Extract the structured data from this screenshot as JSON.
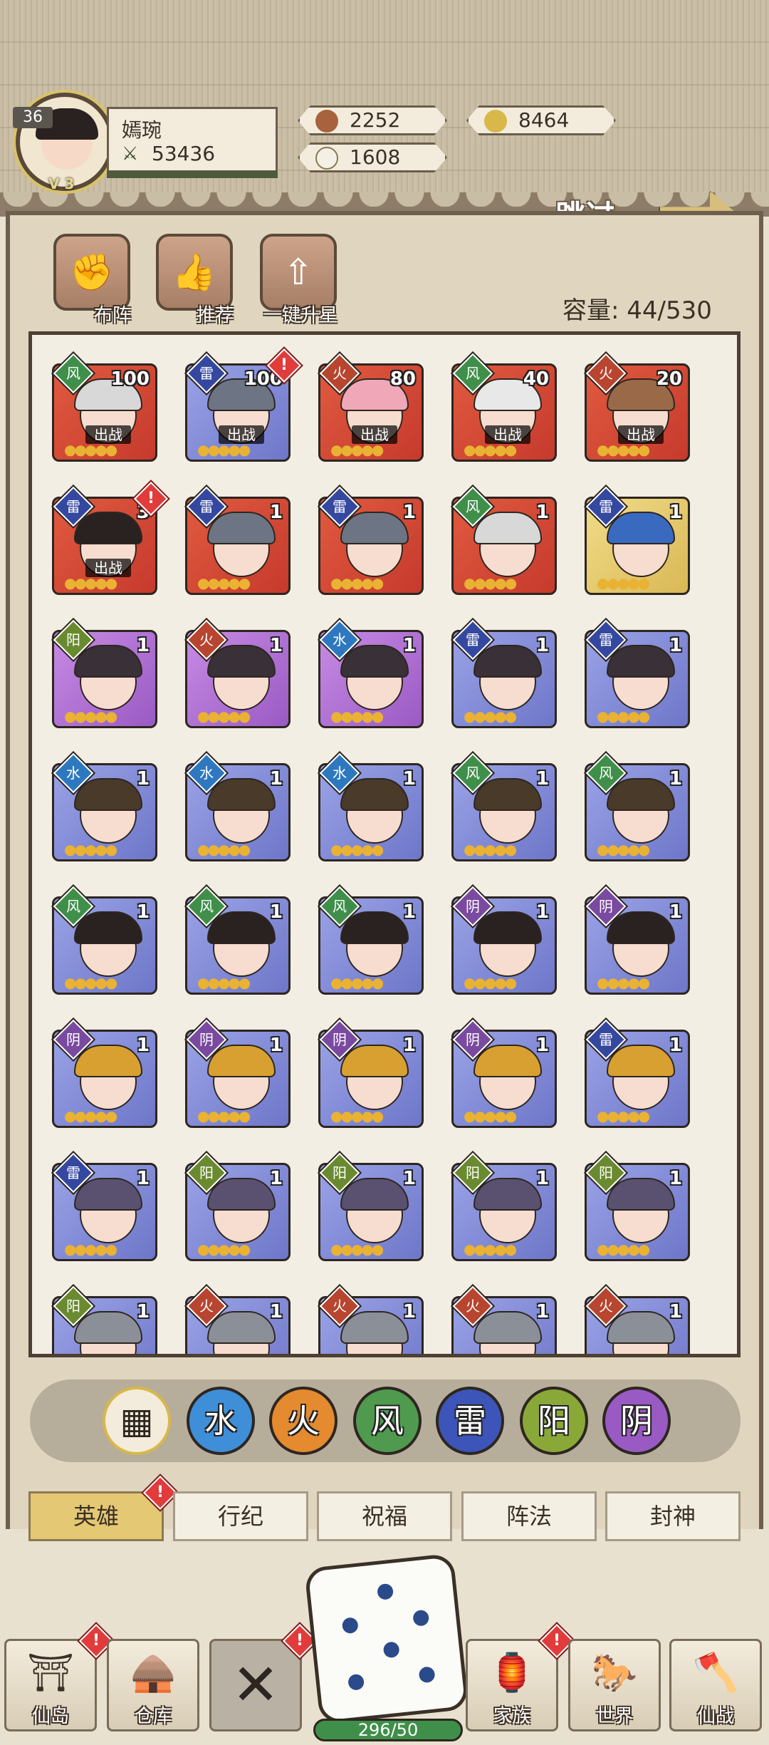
{
  "player": {
    "level": "36",
    "name": "嫣琬",
    "power": "53436",
    "vip": "V 3"
  },
  "resources": {
    "coins": "2252",
    "gold_ingot": "8464",
    "jade": "1608"
  },
  "skip_label": "跳过",
  "actions": {
    "formation": "布阵",
    "recommend": "推荐",
    "upgrade_all": "一键升星"
  },
  "capacity": "容量: 44/530",
  "heroes": [
    {
      "elem": "风",
      "count": "100",
      "deploy": "出战",
      "bg": "red"
    },
    {
      "elem": "雷",
      "count": "100",
      "deploy": "出战",
      "bg": "blue",
      "alert": true
    },
    {
      "elem": "火",
      "count": "80",
      "deploy": "出战",
      "bg": "red"
    },
    {
      "elem": "风",
      "count": "40",
      "deploy": "出战",
      "bg": "red"
    },
    {
      "elem": "火",
      "count": "20",
      "deploy": "出战",
      "bg": "red"
    },
    {
      "elem": "雷",
      "count": "3",
      "deploy": "出战",
      "bg": "red",
      "alert": true
    },
    {
      "elem": "雷",
      "count": "1",
      "bg": "red"
    },
    {
      "elem": "雷",
      "count": "1",
      "bg": "red"
    },
    {
      "elem": "风",
      "count": "1",
      "bg": "red"
    },
    {
      "elem": "雷",
      "count": "1",
      "bg": "gold"
    },
    {
      "elem": "阳",
      "count": "1",
      "bg": "purple"
    },
    {
      "elem": "火",
      "count": "1",
      "bg": "purple"
    },
    {
      "elem": "水",
      "count": "1",
      "bg": "purple"
    },
    {
      "elem": "雷",
      "count": "1",
      "bg": "blue"
    },
    {
      "elem": "雷",
      "count": "1",
      "bg": "blue"
    },
    {
      "elem": "水",
      "count": "1",
      "bg": "blue"
    },
    {
      "elem": "水",
      "count": "1",
      "bg": "blue"
    },
    {
      "elem": "水",
      "count": "1",
      "bg": "blue"
    },
    {
      "elem": "风",
      "count": "1",
      "bg": "blue"
    },
    {
      "elem": "风",
      "count": "1",
      "bg": "blue"
    },
    {
      "elem": "风",
      "count": "1",
      "bg": "blue"
    },
    {
      "elem": "风",
      "count": "1",
      "bg": "blue"
    },
    {
      "elem": "风",
      "count": "1",
      "bg": "blue"
    },
    {
      "elem": "阴",
      "count": "1",
      "bg": "blue"
    },
    {
      "elem": "阴",
      "count": "1",
      "bg": "blue"
    },
    {
      "elem": "阴",
      "count": "1",
      "bg": "blue"
    },
    {
      "elem": "阴",
      "count": "1",
      "bg": "blue"
    },
    {
      "elem": "阴",
      "count": "1",
      "bg": "blue"
    },
    {
      "elem": "阴",
      "count": "1",
      "bg": "blue"
    },
    {
      "elem": "雷",
      "count": "1",
      "bg": "blue"
    },
    {
      "elem": "雷",
      "count": "1",
      "bg": "blue"
    },
    {
      "elem": "阳",
      "count": "1",
      "bg": "blue"
    },
    {
      "elem": "阳",
      "count": "1",
      "bg": "blue"
    },
    {
      "elem": "阳",
      "count": "1",
      "bg": "blue"
    },
    {
      "elem": "阳",
      "count": "1",
      "bg": "blue"
    },
    {
      "elem": "阳",
      "count": "1",
      "bg": "blue"
    },
    {
      "elem": "火",
      "count": "1",
      "bg": "blue"
    },
    {
      "elem": "火",
      "count": "1",
      "bg": "blue"
    },
    {
      "elem": "火",
      "count": "1",
      "bg": "blue"
    },
    {
      "elem": "火",
      "count": "1",
      "bg": "blue"
    }
  ],
  "element_filters": [
    "水",
    "火",
    "风",
    "雷",
    "阳",
    "阴"
  ],
  "tabs": [
    "英雄",
    "行纪",
    "祝福",
    "阵法",
    "封神"
  ],
  "nav": {
    "island": "仙岛",
    "warehouse": "仓库",
    "clan": "家族",
    "world": "世界",
    "battle": "仙战",
    "energy": "296/50"
  }
}
